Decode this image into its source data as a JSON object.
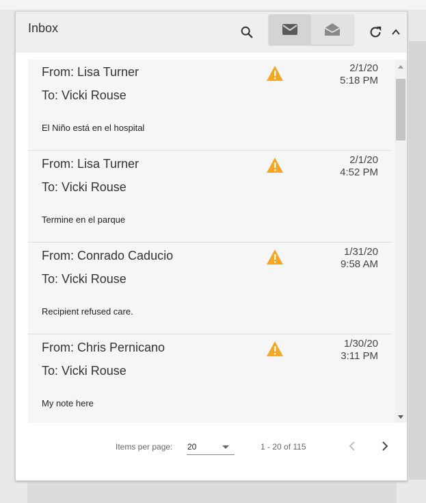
{
  "header": {
    "title": "Inbox",
    "icons": [
      "search-icon",
      "mail-icon",
      "drafts-icon",
      "refresh-icon",
      "chevron-up-icon"
    ]
  },
  "messages": [
    {
      "from": "From: Lisa Turner",
      "to": "To: Vicki Rouse",
      "preview": "El Niño está en el hospital",
      "date": "2/1/20",
      "time": "5:18 PM",
      "icon": "warning-icon"
    },
    {
      "from": "From: Lisa Turner",
      "to": "To: Vicki Rouse",
      "preview": "Termine en el parque",
      "date": "2/1/20",
      "time": "4:52 PM",
      "icon": "warning-icon"
    },
    {
      "from": "From: Conrado Caducio",
      "to": "To: Vicki Rouse",
      "preview": "Recipient refused care.",
      "date": "1/31/20",
      "time": "9:58 AM",
      "icon": "warning-icon"
    },
    {
      "from": "From: Chris Pernicano",
      "to": "To: Vicki Rouse",
      "preview": "My note here",
      "date": "1/30/20",
      "time": "3:11 PM",
      "icon": "warning-icon"
    }
  ],
  "paginator": {
    "items_per_page_label": "Items per page:",
    "items_per_page": "20",
    "range_label": "1 - 20 of 115"
  },
  "colors": {
    "warning": "#f5a623",
    "toolbar_bg": "#efefef",
    "list_bg": "#f6f6f6"
  }
}
